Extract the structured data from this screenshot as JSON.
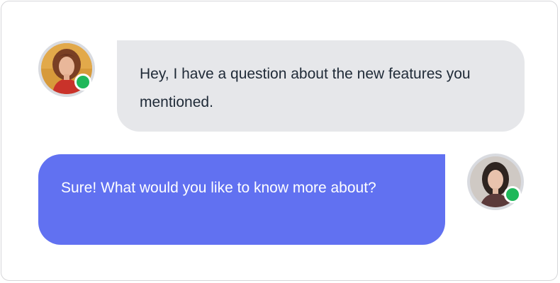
{
  "chat": {
    "messages": [
      {
        "sender": "contact",
        "text": "Hey, I have a question about the new features you mentioned.",
        "avatar_icon": "user-avatar-woman-red-hair",
        "status": "online"
      },
      {
        "sender": "self",
        "text": "Sure! What would you like to know more about?",
        "avatar_icon": "user-avatar-woman-dark-hair",
        "status": "online"
      }
    ]
  },
  "colors": {
    "incoming_bubble": "#e6e7ea",
    "outgoing_bubble": "#6171f1",
    "online_status": "#1fb85a"
  }
}
